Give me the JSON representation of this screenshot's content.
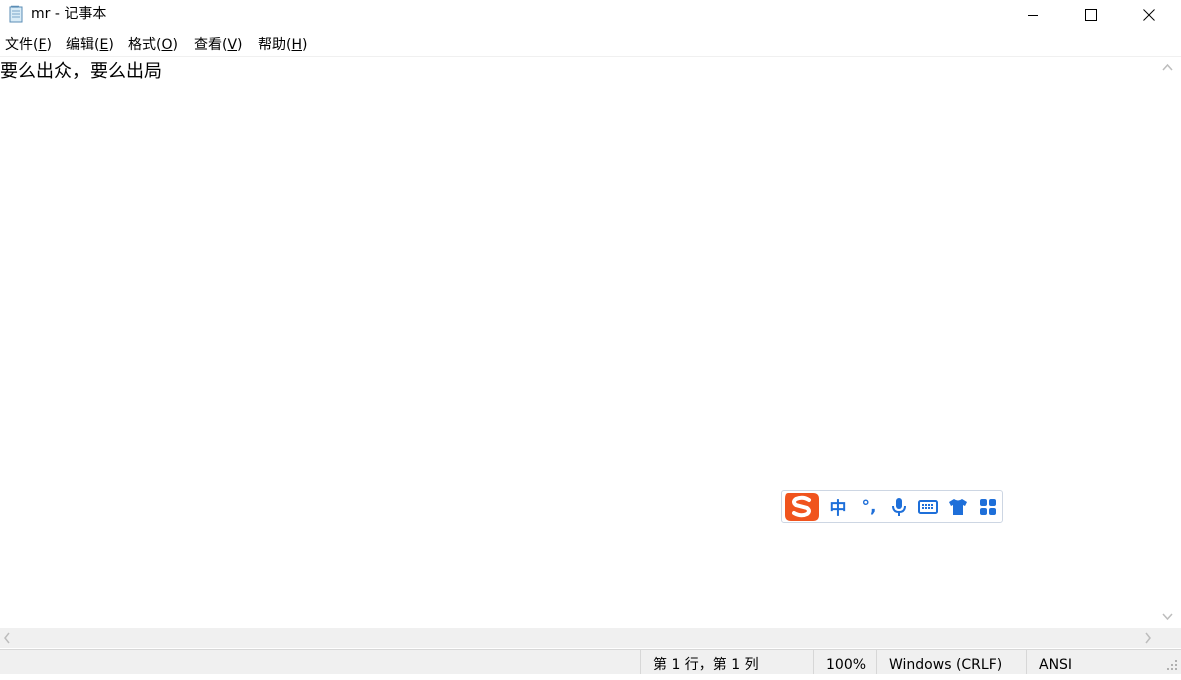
{
  "window": {
    "title": "mr - 记事本",
    "controls": {
      "minimize": "minimize",
      "maximize": "maximize",
      "close": "close"
    }
  },
  "menu": [
    {
      "label": "文件(",
      "accel": "F",
      "suffix": ")"
    },
    {
      "label": "编辑(",
      "accel": "E",
      "suffix": ")"
    },
    {
      "label": "格式(",
      "accel": "O",
      "suffix": ")"
    },
    {
      "label": "查看(",
      "accel": "V",
      "suffix": ")"
    },
    {
      "label": "帮助(",
      "accel": "H",
      "suffix": ")"
    }
  ],
  "editor": {
    "content": "要么出众，要么出局"
  },
  "status": {
    "position": "第 1 行，第 1 列",
    "zoom": "100%",
    "line_ending": "Windows (CRLF)",
    "encoding": "ANSI"
  },
  "ime": {
    "mode": "中",
    "punct": "°,",
    "icons": [
      "sogou-logo-icon",
      "microphone-icon",
      "keyboard-icon",
      "skin-shirt-icon",
      "toolbox-grid-icon"
    ],
    "colors": {
      "logo": "#f0541e",
      "accent": "#1e6fd9"
    }
  },
  "colors": {
    "chrome": "#f0f0f0",
    "border": "#d7d7d7",
    "background": "#ffffff"
  }
}
